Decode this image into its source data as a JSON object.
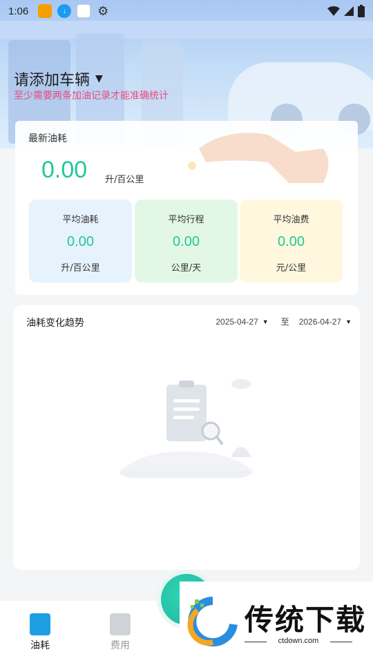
{
  "status_bar": {
    "time": "1:06",
    "icons": [
      "app-notification-icon",
      "download-icon",
      "news-icon",
      "settings-icon"
    ],
    "right_icons": [
      "wifi-icon",
      "signal-icon",
      "battery-icon"
    ]
  },
  "header": {
    "vehicle_selector": "请添加车辆",
    "hint": "至少需要两条加油记录才能准确统计"
  },
  "latest": {
    "title": "最新油耗",
    "value": "0.00",
    "unit": "升/百公里",
    "stats": [
      {
        "label": "平均油耗",
        "value": "0.00",
        "unit": "升/百公里"
      },
      {
        "label": "平均行程",
        "value": "0.00",
        "unit": "公里/天"
      },
      {
        "label": "平均油费",
        "value": "0.00",
        "unit": "元/公里"
      }
    ]
  },
  "trend": {
    "title": "油耗变化趋势",
    "start_date": "2025-04-27",
    "to_label": "至",
    "end_date": "2026-04-27"
  },
  "bottom_nav": {
    "items": [
      {
        "label": "油耗",
        "icon": "fuel-can-icon"
      },
      {
        "label": "费用",
        "icon": "expense-icon"
      }
    ]
  },
  "watermark": {
    "name": "传统下载",
    "url": "ctdown.com"
  },
  "colors": {
    "accent": "#20c997",
    "hint": "#e64980",
    "nav_active": "#1e9ee3"
  }
}
